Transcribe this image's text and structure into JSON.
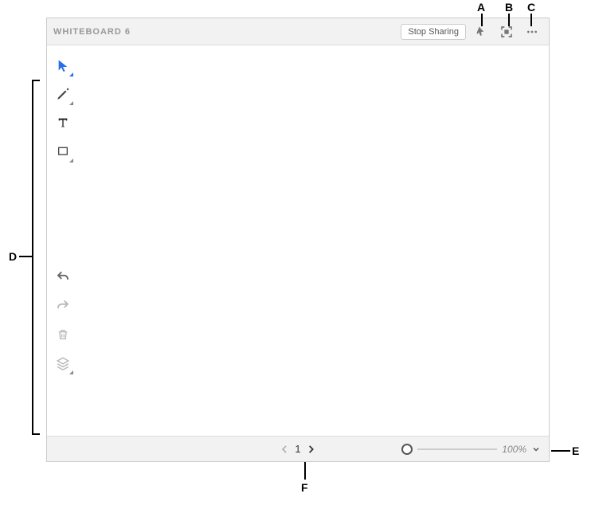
{
  "header": {
    "title": "WHITEBOARD 6",
    "stop_label": "Stop Sharing"
  },
  "footer": {
    "page": "1",
    "zoom": "100%"
  },
  "callouts": {
    "A": "A",
    "B": "B",
    "C": "C",
    "D": "D",
    "E": "E",
    "F": "F"
  },
  "tools": {
    "select": "select-tool",
    "pen": "pen-tool",
    "text": "text-tool",
    "shape": "shape-tool",
    "undo": "undo",
    "redo": "redo",
    "delete": "delete",
    "layers": "layers"
  }
}
